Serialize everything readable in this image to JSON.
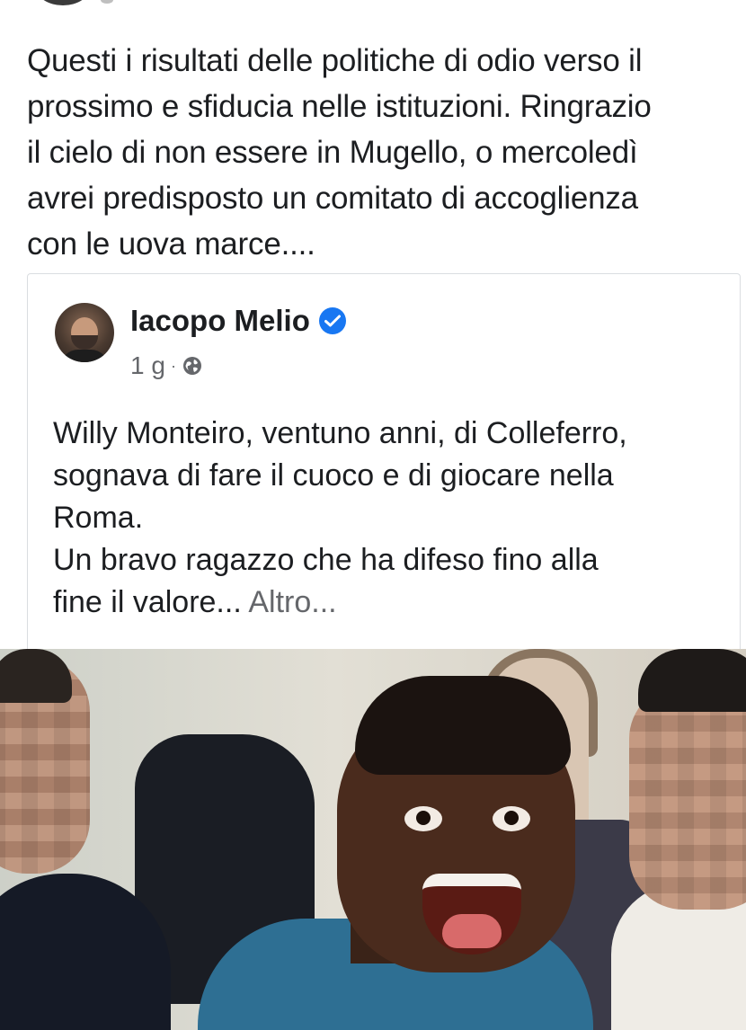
{
  "post": {
    "text_lines": [
      "Questi i risultati delle politiche di odio verso il",
      "prossimo e sfiducia nelle istituzioni. Ringrazio",
      "il cielo di non essere in Mugello, o mercoledì",
      "avrei predisposto un comitato di accoglienza",
      "con le uova marce...."
    ]
  },
  "shared_post": {
    "author_name": "Iacopo Melio",
    "verified_icon": "verified-badge-icon",
    "timestamp": "1 g",
    "separator": "·",
    "privacy_icon": "globe-icon",
    "text_lines": [
      "Willy Monteiro, ventuno anni, di Colleferro,",
      "sognava di fare il cuoco e di giocare nella",
      "Roma.",
      "Un bravo ragazzo che ha difeso fino alla"
    ],
    "last_line": "fine il valore...",
    "more_label": "Altro...",
    "accent_color": "#1877f2"
  }
}
